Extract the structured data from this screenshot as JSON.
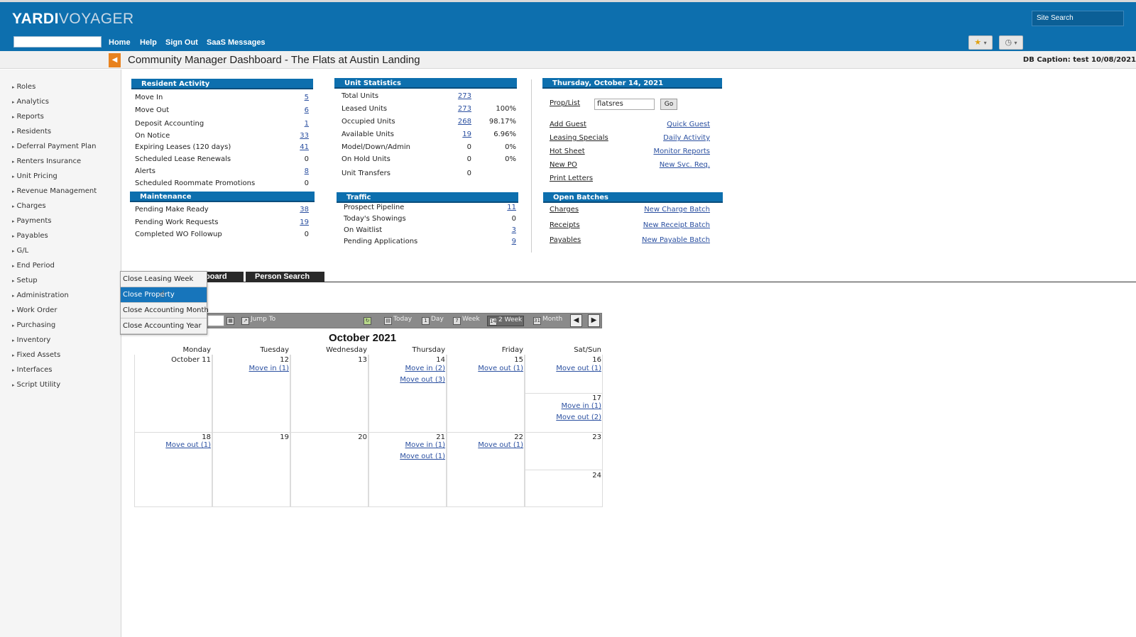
{
  "header": {
    "logo_a": "YARDI",
    "logo_b": "VOYAGER",
    "nav": [
      "Home",
      "Help",
      "Sign Out",
      "SaaS Messages"
    ],
    "site_search_placeholder": "Site Search",
    "fav_icon": "star-icon",
    "history_icon": "clock-icon",
    "accent": "#0d6fae"
  },
  "titlebar": {
    "title": "Community Manager Dashboard - The Flats at Austin Landing",
    "db_caption": "DB Caption: test 10/08/2021"
  },
  "sidebar": {
    "items": [
      "Roles",
      "Analytics",
      "Reports",
      "Residents",
      "Deferral Payment Plan",
      "Renters Insurance",
      "Unit Pricing",
      "Revenue Management",
      "Charges",
      "Payments",
      "Payables",
      "G/L",
      "End Period",
      "Setup",
      "Administration",
      "Work Order",
      "Purchasing",
      "Inventory",
      "Fixed Assets",
      "Interfaces",
      "Script Utility"
    ]
  },
  "resident_activity": {
    "title": "Resident Activity",
    "rows": [
      {
        "label": "Move In",
        "value": "5",
        "link": true
      },
      {
        "label": "Move Out",
        "value": "6",
        "link": true
      },
      {
        "label": "Deposit Accounting",
        "value": "1",
        "link": true
      },
      {
        "label": "On Notice",
        "value": "33",
        "link": true
      },
      {
        "label": "Expiring Leases (120 days)",
        "value": "41",
        "link": true
      },
      {
        "label": "Scheduled Lease Renewals",
        "value": "0",
        "link": false
      },
      {
        "label": "Alerts",
        "value": "8",
        "link": true
      },
      {
        "label": "Scheduled Roommate Promotions",
        "value": "0",
        "link": false
      }
    ]
  },
  "maintenance": {
    "title": "Maintenance",
    "rows": [
      {
        "label": "Pending Make Ready",
        "value": "38",
        "link": true
      },
      {
        "label": "Pending Work Requests",
        "value": "19",
        "link": true
      },
      {
        "label": "Completed WO Followup",
        "value": "0",
        "link": false
      }
    ]
  },
  "unit_statistics": {
    "title": "Unit Statistics",
    "rows": [
      {
        "label": "Total Units",
        "value": "273",
        "pct": "",
        "link": true
      },
      {
        "label": "Leased Units",
        "value": "273",
        "pct": "100%",
        "link": true
      },
      {
        "label": "Occupied Units",
        "value": "268",
        "pct": "98.17%",
        "link": true
      },
      {
        "label": "Available Units",
        "value": "19",
        "pct": "6.96%",
        "link": true
      },
      {
        "label": "Model/Down/Admin",
        "value": "0",
        "pct": "0%",
        "link": false
      },
      {
        "label": "On Hold Units",
        "value": "0",
        "pct": "0%",
        "link": false
      },
      {
        "label": "Unit Transfers",
        "value": "0",
        "pct": "",
        "link": false
      }
    ]
  },
  "traffic": {
    "title": "Traffic",
    "rows": [
      {
        "label": "Prospect Pipeline",
        "value": "11",
        "link": true
      },
      {
        "label": "Today's Showings",
        "value": "0",
        "link": false
      },
      {
        "label": "On Waitlist",
        "value": "3",
        "link": true
      },
      {
        "label": "Pending Applications",
        "value": "9",
        "link": true
      }
    ]
  },
  "date_panel": {
    "title": "Thursday, October 14, 2021",
    "prop_list_label": "Prop/List",
    "prop_value": "flatsres",
    "go_label": "Go",
    "links_left": [
      "Add Guest",
      "Leasing Specials",
      "Hot Sheet",
      "New PO",
      "Print Letters"
    ],
    "links_right": [
      "Quick Guest",
      "Daily Activity",
      "Monitor Reports",
      "New Svc. Req."
    ]
  },
  "open_batches": {
    "title": "Open Batches",
    "links_left": [
      "Charges",
      "Receipts",
      "Payables"
    ],
    "links_right": [
      "New Charge Batch",
      "New Receipt Batch",
      "New Payable Batch"
    ]
  },
  "tabs": {
    "dashboard_partial": "board",
    "person_search": "Person Search"
  },
  "dropdown": {
    "items": [
      "Close Leasing Week",
      "Close Property",
      "Close Accounting Month",
      "Close Accounting Year"
    ],
    "selected_index": 1
  },
  "cal_toolbar": {
    "jump_to": "Jump To",
    "today": "Today",
    "day": "Day",
    "week": "Week",
    "two_week": "2 Week",
    "month": "Month",
    "selected": "2 Week"
  },
  "calendar": {
    "title": "October 2021",
    "days": [
      "Monday",
      "Tuesday",
      "Wednesday",
      "Thursday",
      "Friday",
      "Sat/Sun"
    ],
    "week1": {
      "mon": "October 11",
      "tue": "12",
      "wed": "13",
      "thu": "14",
      "fri": "15",
      "sat": "16",
      "sun": "17",
      "tue_ev": [
        "Move in (1)"
      ],
      "thu_ev": [
        "Move in (2)",
        "Move out (3)"
      ],
      "fri_ev": [
        "Move out (1)"
      ],
      "sat_ev": [
        "Move out (1)"
      ],
      "sun_ev": [
        "Move in (1)",
        "Move out (2)"
      ]
    },
    "week2": {
      "mon": "18",
      "tue": "19",
      "wed": "20",
      "thu": "21",
      "fri": "22",
      "sat": "23",
      "sun": "24",
      "mon_ev": [
        "Move out (1)"
      ],
      "thu_ev": [
        "Move in (1)",
        "Move out (1)"
      ],
      "fri_ev": [
        "Move out (1)"
      ]
    }
  }
}
